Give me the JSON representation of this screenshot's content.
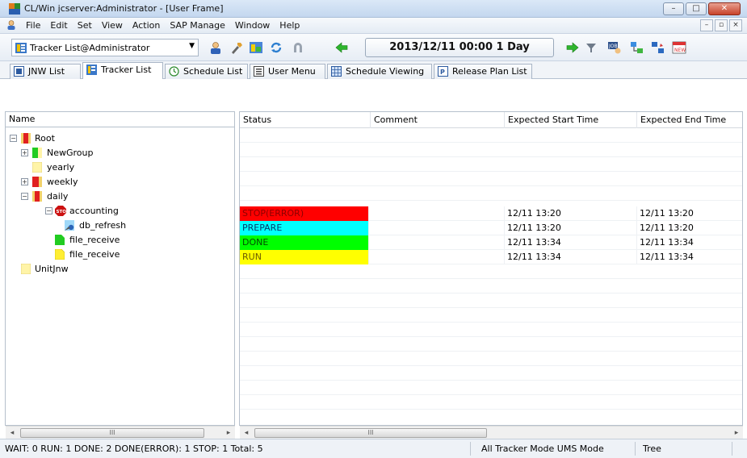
{
  "window": {
    "title": "CL/Win jcserver:Administrator - [User Frame]",
    "minimize_label": "–",
    "maximize_label": "□",
    "close_label": "✕"
  },
  "menubar": {
    "items": [
      "File",
      "Edit",
      "Set",
      "View",
      "Action",
      "SAP Manage",
      "Window",
      "Help"
    ],
    "mdi_minimize": "–",
    "mdi_restore": "▫",
    "mdi_close": "×"
  },
  "toolbar": {
    "tracker_select_value": "Tracker List@Administrator",
    "date_display": "2013/12/11 00:00  1 Day"
  },
  "tabs": [
    {
      "label": "JNW List",
      "icon": "jnw-list-icon"
    },
    {
      "label": "Tracker List",
      "icon": "tracker-list-icon",
      "active": true
    },
    {
      "label": "Schedule List",
      "icon": "schedule-list-icon"
    },
    {
      "label": "User Menu",
      "icon": "user-menu-icon"
    },
    {
      "label": "Schedule Viewing",
      "icon": "schedule-viewing-icon"
    },
    {
      "label": "Release Plan List",
      "icon": "release-plan-list-icon"
    }
  ],
  "tree": {
    "header": "Name",
    "nodes": [
      {
        "label": "Root",
        "expander": "−",
        "icon_color": "#e02020"
      },
      {
        "label": "NewGroup",
        "expander": "+",
        "icon_color": "#22cc22"
      },
      {
        "label": "yearly",
        "expander": "",
        "icon_color": "#ffee66"
      },
      {
        "label": "weekly",
        "expander": "+",
        "icon_color": "#e02020"
      },
      {
        "label": "daily",
        "expander": "−",
        "icon_color": "#e02020"
      },
      {
        "label": "accounting",
        "expander": "−",
        "icon_color": "#cc1111"
      },
      {
        "label": "db_refresh",
        "expander": "",
        "icon_color": "#4aa0e0"
      },
      {
        "label": "file_receive",
        "expander": "",
        "icon_color": "#22cc22"
      },
      {
        "label": "file_receive",
        "expander": "",
        "icon_color": "#ffee33"
      },
      {
        "label": "UnitJnw",
        "expander": "",
        "icon_color": "#ffee66"
      }
    ]
  },
  "grid": {
    "headers": [
      "Status",
      "Comment",
      "Expected Start Time",
      "Expected End Time"
    ],
    "rows": [
      {
        "status": "STOP(ERROR)",
        "status_color": "#ff0000",
        "comment": "",
        "start": "12/11 13:20",
        "end": "12/11 13:20"
      },
      {
        "status": "PREPARE",
        "status_color": "#00ffff",
        "comment": "",
        "start": "12/11 13:20",
        "end": "12/11 13:20"
      },
      {
        "status": "DONE",
        "status_color": "#00ff00",
        "comment": "",
        "start": "12/11 13:34",
        "end": "12/11 13:34"
      },
      {
        "status": "RUN",
        "status_color": "#ffff00",
        "comment": "",
        "start": "12/11 13:34",
        "end": "12/11 13:34"
      }
    ]
  },
  "scroll": {
    "left_arrow": "◂",
    "right_arrow": "▸",
    "thumb_grip": "III"
  },
  "statusbar": {
    "counts": "WAIT: 0   RUN: 1   DONE: 2   DONE(ERROR): 1   STOP: 1   Total: 5",
    "mode": "All Tracker Mode  UMS Mode",
    "view": "Tree"
  }
}
